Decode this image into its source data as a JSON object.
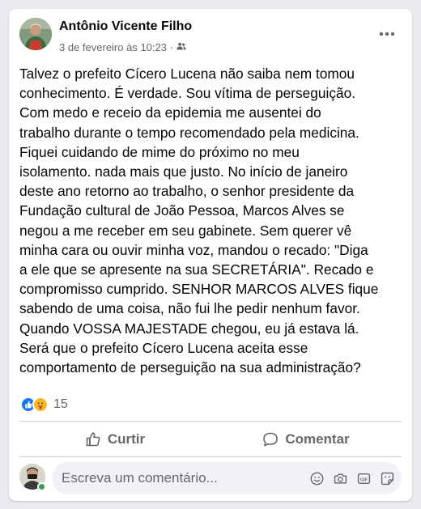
{
  "post": {
    "author": "Antônio Vicente Filho",
    "date": "3 de fevereiro às 10:23",
    "separator": "·",
    "audience_icon": "friends-icon",
    "text": "Talvez o prefeito Cícero Lucena não saiba nem tomou\nconhecimento. É verdade. Sou vítima de perseguição.\nCom medo e receio da epidemia me ausentei do\ntrabalho durante o tempo recomendado pela medicina.\nFiquei cuidando de mime do próximo no meu\nisolamento. nada mais que justo. No início de janeiro\ndeste ano retorno ao trabalho, o senhor presidente da\nFundação cultural de João Pessoa, Marcos Alves se\nnegou a me receber em seu gabinete. Sem querer vê\nminha cara ou ouvir minha voz, mandou o recado: \"Diga\na ele que se apresente na sua SECRETÁRIA\". Recado e\ncompromisso cumprido. SENHOR MARCOS ALVES fique\nsabendo de uma coisa, não fui lhe pedir nenhum favor.\nQuando VOSSA MAJESTADE chegou, eu já estava lá.\nSerá que o prefeito Cícero Lucena aceita esse\ncomportamento de perseguição na sua administração?"
  },
  "reactions": {
    "count": "15",
    "types": [
      "like-icon",
      "care-icon"
    ]
  },
  "actions": {
    "like_label": "Curtir",
    "comment_label": "Comentar"
  },
  "comment": {
    "placeholder": "Escreva um comentário...",
    "tools": [
      "emoji-icon",
      "camera-icon",
      "gif-icon",
      "sticker-icon"
    ]
  },
  "colors": {
    "background": "#e9ebee",
    "card": "#ffffff",
    "text": "#050505",
    "secondary": "#65676b",
    "like_blue": "#1877f2",
    "care_yellow": "#f7b928",
    "online_green": "#31a24c"
  }
}
